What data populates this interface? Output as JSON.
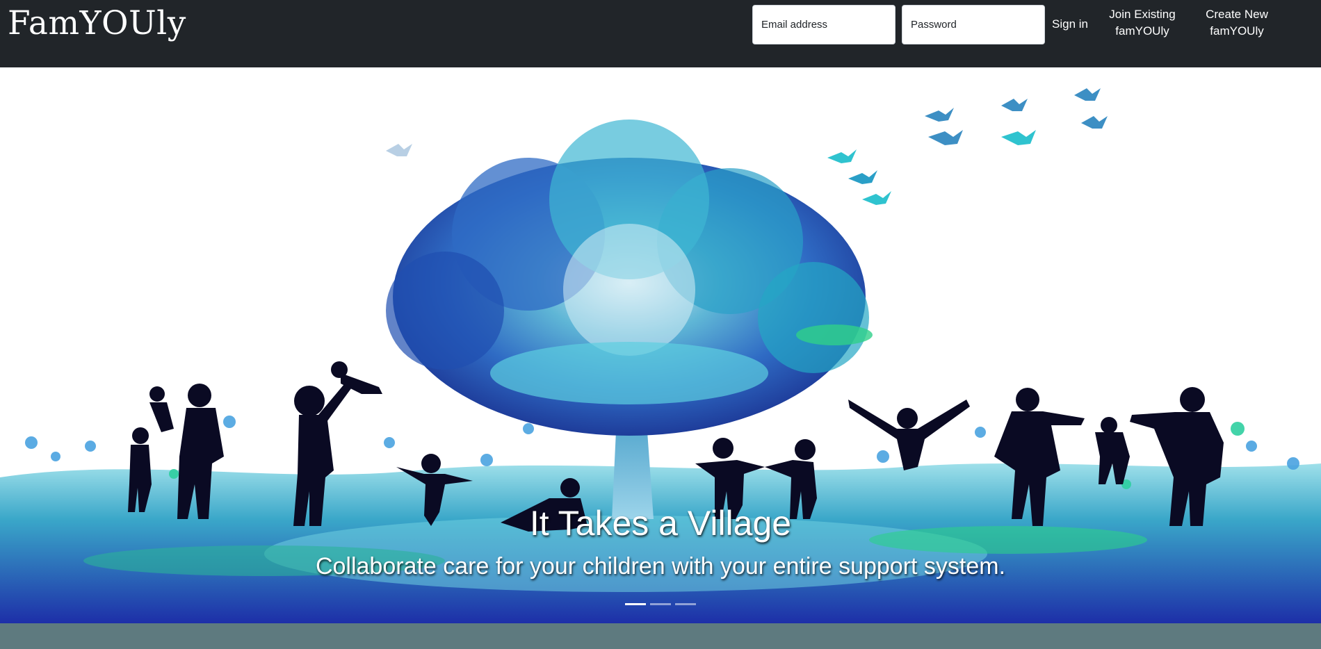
{
  "brand": {
    "name": "FamYOUly"
  },
  "header": {
    "email_placeholder": "Email address",
    "password_placeholder": "Password",
    "sign_in": "Sign in",
    "join_line1": "Join Existing",
    "join_line2": "famYOUly",
    "create_line1": "Create New",
    "create_line2": "famYOUly"
  },
  "carousel": {
    "title": "It Takes a Village",
    "text": "Collaborate care for your children with your entire support system.",
    "active_slide": 1,
    "slide_count": 3
  },
  "colors": {
    "navbar": "#212529",
    "footer_band": "#5e7a7f",
    "tree_dark": "#1f3f9e",
    "tree_teal": "#2fc3cf",
    "silhouette": "#0a0a23"
  }
}
